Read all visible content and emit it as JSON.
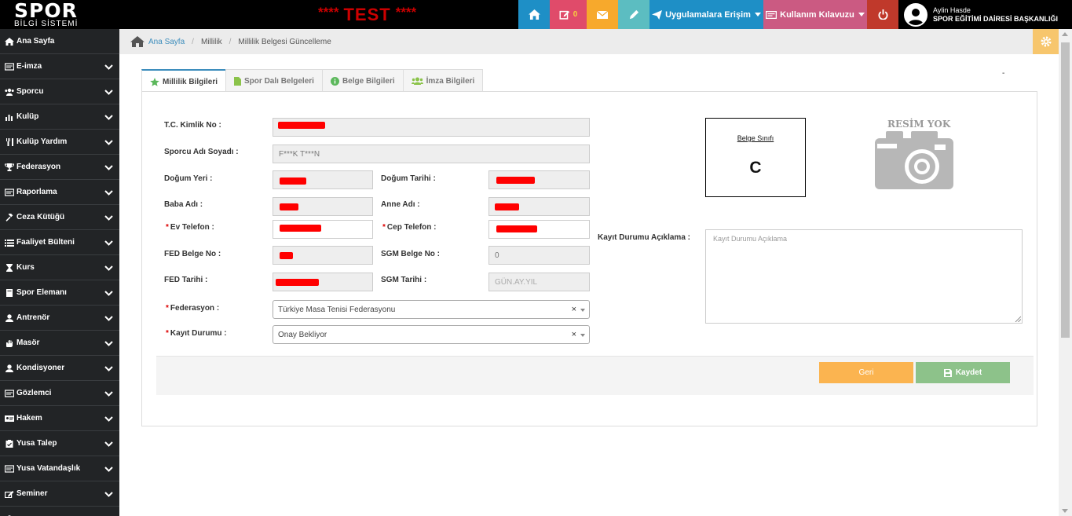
{
  "app": {
    "logo_main": "SPOR",
    "logo_sub": "BİLGİ SİSTEMİ",
    "test_stars": "****",
    "test_text": "TEST"
  },
  "topbar": {
    "notification_count": "0",
    "apps_label": "Uygulamalara Erişim",
    "guide_label": "Kullanım Kılavuzu",
    "user_name": "Aylin Hasde",
    "user_org": "SPOR EĞİTİMİ DAİRESİ BAŞKANLIĞI"
  },
  "sidebar": {
    "items": [
      {
        "label": "Ana Sayfa",
        "icon": "home-icon"
      },
      {
        "label": "E-imza",
        "icon": "card-icon"
      },
      {
        "label": "Sporcu",
        "icon": "users-icon"
      },
      {
        "label": "Kulüp",
        "icon": "bar-chart-icon"
      },
      {
        "label": "Kulüp Yardım",
        "icon": "fork-icon"
      },
      {
        "label": "Federasyon",
        "icon": "trophy-icon"
      },
      {
        "label": "Raporlama",
        "icon": "card-icon"
      },
      {
        "label": "Ceza Kütüğü",
        "icon": "gavel-icon"
      },
      {
        "label": "Faaliyet Bülteni",
        "icon": "list-icon"
      },
      {
        "label": "Kurs",
        "icon": "hourglass-icon"
      },
      {
        "label": "Spor Elemanı",
        "icon": "book-icon"
      },
      {
        "label": "Antrenör",
        "icon": "user-icon"
      },
      {
        "label": "Masör",
        "icon": "hand-icon"
      },
      {
        "label": "Kondisyoner",
        "icon": "user-icon"
      },
      {
        "label": "Gözlemci",
        "icon": "card-icon"
      },
      {
        "label": "Hakem",
        "icon": "id-card-icon"
      },
      {
        "label": "Yusa Talep",
        "icon": "clipboard-icon"
      },
      {
        "label": "Yusa Vatandaşlık",
        "icon": "card-icon"
      },
      {
        "label": "Seminer",
        "icon": "edit-icon"
      },
      {
        "label": "",
        "icon": "user-icon"
      }
    ]
  },
  "breadcrumb": {
    "home": "Ana Sayfa",
    "level1": "Millilik",
    "level2": "Millilik Belgesi Güncelleme"
  },
  "tabs": [
    {
      "label": "Millilik Bilgileri",
      "icon": "star-icon",
      "color": "#5cb85c"
    },
    {
      "label": "Spor Dalı Belgeleri",
      "icon": "file-icon",
      "color": "#8bc34a"
    },
    {
      "label": "Belge Bilgileri",
      "icon": "info-icon",
      "color": "#5cb85c"
    },
    {
      "label": "İmza Bilgileri",
      "icon": "users-icon",
      "color": "#8bc34a"
    }
  ],
  "tab_extra": "-",
  "form": {
    "tc_label": "T.C. Kimlik No :",
    "name_label": "Sporcu Adı Soyadı :",
    "name_value": "F***K T***N",
    "birthplace_label": "Doğum Yeri :",
    "birthdate_label": "Doğum Tarihi :",
    "father_label": "Baba Adı :",
    "mother_label": "Anne Adı :",
    "home_phone_label": "Ev Telefon :",
    "mobile_label": "Cep Telefon :",
    "fed_no_label": "FED Belge No :",
    "sgm_no_label": "SGM Belge No :",
    "sgm_no_value": "0",
    "fed_date_label": "FED Tarihi :",
    "sgm_date_label": "SGM Tarihi :",
    "sgm_date_placeholder": "GÜN.AY.YIL",
    "federation_label": "Federasyon :",
    "federation_value": "Türkiye Masa Tenisi Federasyonu",
    "status_label": "Kayıt Durumu :",
    "status_value": "Onay Bekliyor",
    "status_note_label": "Kayıt Durumu Açıklama :",
    "status_note_placeholder": "Kayıt Durumu Açıklama",
    "required_mark": "*",
    "clear_mark": "×"
  },
  "document": {
    "class_label": "Belge Sınıfı",
    "class_value": "C"
  },
  "photo": {
    "no_photo": "RESİM YOK"
  },
  "actions": {
    "back": "Geri",
    "save": "Kaydet"
  },
  "colors": {
    "redaction": "#ff0000",
    "accent": "#3c8dbc"
  }
}
